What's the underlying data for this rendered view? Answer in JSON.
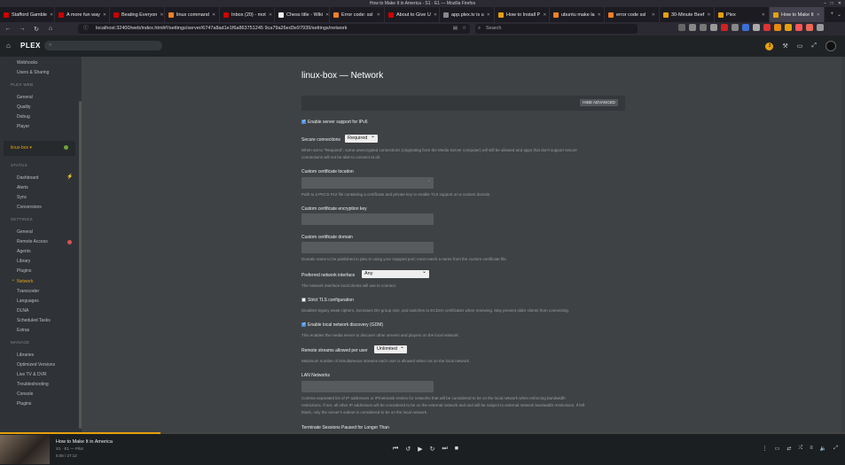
{
  "window": {
    "title": "How to Make It in America - S1 · E1 — Mozilla Firefox"
  },
  "tabs": [
    {
      "label": "Stafford Gamble",
      "color": "#cc0000"
    },
    {
      "label": "A more fun way",
      "color": "#cc0000"
    },
    {
      "label": "Beating Everyon",
      "color": "#cc0000"
    },
    {
      "label": "linux command",
      "color": "#f48024"
    },
    {
      "label": "Inbox (20) - mot",
      "color": "#cc0000"
    },
    {
      "label": "Chess title - Wiki",
      "color": "#eeeeee"
    },
    {
      "label": "Error code: ssl",
      "color": "#f48024"
    },
    {
      "label": "About to Give U",
      "color": "#cc0000"
    },
    {
      "label": "app.plex.tv is u",
      "color": "#888888"
    },
    {
      "label": "How to Install P",
      "color": "#e5a00d"
    },
    {
      "label": "ubuntu make la",
      "color": "#f48024"
    },
    {
      "label": "error code ssl",
      "color": "#f48024"
    },
    {
      "label": "30-Minute Beef",
      "color": "#e5a00d"
    },
    {
      "label": "Plex",
      "color": "#e5a00d"
    },
    {
      "label": "How to Make It",
      "color": "#e5a00d",
      "active": true
    }
  ],
  "browser": {
    "url": "localhost:32400/web/index.html#!/settings/server/6747a8ad1e1f6a863751245 9ca79a26ed3e97939/settings/network",
    "search_placeholder": "Search"
  },
  "plex": {
    "logo": "PLEX",
    "badge_count": "3"
  },
  "sidebar": {
    "top_items": [
      "Webhooks",
      "Users & Sharing"
    ],
    "plex_web_heading": "PLEX WEB",
    "plex_web_items": [
      "General",
      "Quality",
      "Debug",
      "Player"
    ],
    "server_name": "linux-box ▾",
    "status_heading": "STATUS",
    "status_items": [
      "Dashboard",
      "Alerts",
      "Sync",
      "Conversions"
    ],
    "settings_heading": "SETTINGS",
    "settings_items": [
      "General",
      "Remote Access",
      "Agents",
      "Library",
      "Plugins",
      "Network",
      "Transcoder",
      "Languages",
      "DLNA",
      "Scheduled Tasks",
      "Extras"
    ],
    "manage_heading": "MANAGE",
    "manage_items": [
      "Libraries",
      "Optimized Versions",
      "Live TV & DVR",
      "Troubleshooting",
      "Console",
      "Plugins"
    ]
  },
  "page": {
    "title": "linux-box — Network",
    "hide_advanced": "HIDE ADVANCED",
    "ipv6_label": "Enable server support for IPv6",
    "secure_label": "Secure connections",
    "secure_value": "Required",
    "secure_hint": "When set to \"Required\", some unencrypted connections (originating from the Media Server computer) will still be allowed and apps that don't support secure",
    "secure_hint2": "connections will not be able to connect at all.",
    "cert_loc_label": "Custom certificate location",
    "cert_loc_hint": "Path to a PKCS #12 file containing a certificate and private key to enable TLS support on a custom domain.",
    "cert_key_label": "Custom certificate encryption key",
    "cert_domain_label": "Custom certificate domain",
    "cert_domain_hint": "Domain name to be published to plex.tv using your mapped port; must match a name from the custom certificate file.",
    "pref_iface_label": "Preferred network interface",
    "pref_iface_value": "Any",
    "pref_iface_hint": "The network interface local clients will use to connect.",
    "strict_tls_label": "Strict TLS configuration",
    "strict_tls_hint": "Disables legacy weak ciphers, increases DH group size, and switches to ECDSA certificates when renewing. May prevent older clients from connecting.",
    "gdm_label": "Enable local network discovery (GDM)",
    "gdm_hint": "This enables the media server to discover other servers and players on the local network.",
    "streams_label": "Remote streams allowed per user",
    "streams_value": "Unlimited",
    "streams_hint": "Maximum number of simultaneous streams each user is allowed when not on the local network.",
    "lan_label": "LAN Networks",
    "lan_hint1": "Comma separated list of IP addresses or IP/netmask entries for networks that will be considered to be on the local network when enforcing bandwidth",
    "lan_hint2": "restrictions. If set, all other IP addresses will be considered to be on the external network and and will be subject to external network bandwidth restrictions. If left",
    "lan_hint3": "blank, only the server's subnet is considered to be on the local network.",
    "terminate_label": "Terminate Sessions Paused for Longer Than"
  },
  "player": {
    "title": "How to Make It in America",
    "subtitle": "S1 · E1 — Pilot",
    "time": "5:08 / 27:12",
    "progress": 0.19
  }
}
